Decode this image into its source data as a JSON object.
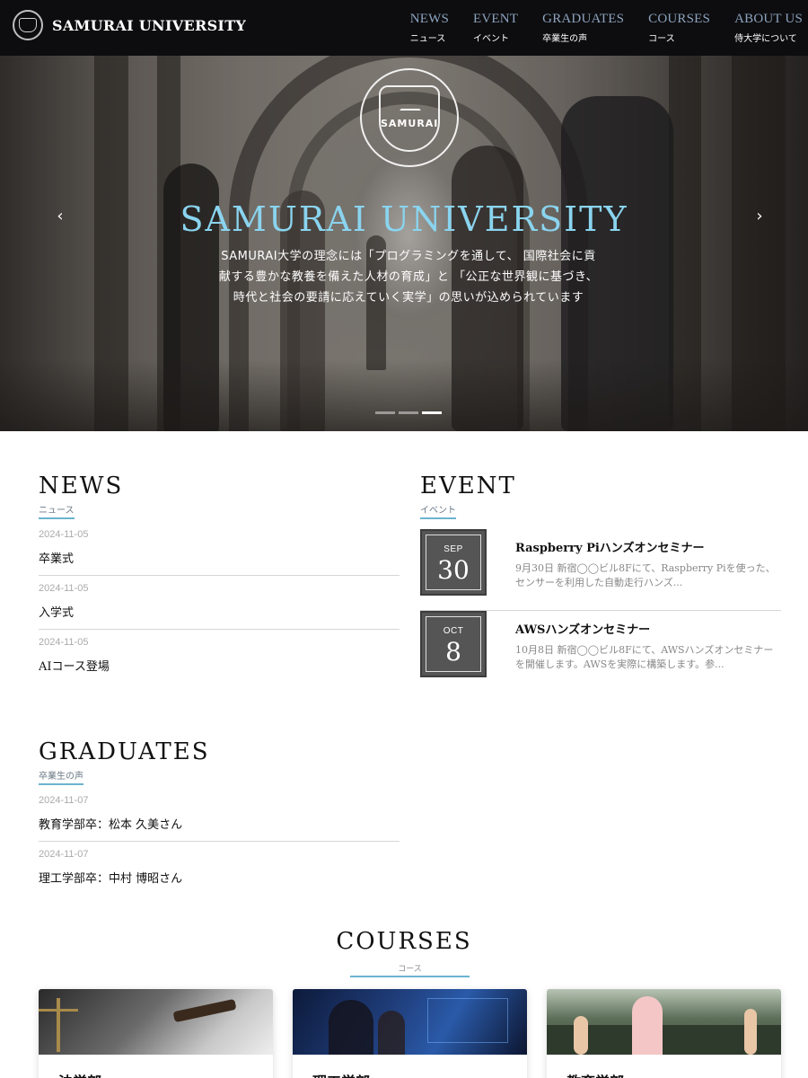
{
  "header": {
    "brand": "SAMURAI UNIVERSITY",
    "nav": [
      {
        "en": "NEWS",
        "jp": "ニュース"
      },
      {
        "en": "EVENT",
        "jp": "イベント"
      },
      {
        "en": "GRADUATES",
        "jp": "卒業生の声"
      },
      {
        "en": "COURSES",
        "jp": "コース"
      },
      {
        "en": "ABOUT US",
        "jp": "侍大学について"
      }
    ]
  },
  "hero": {
    "seal_text": "SAMURAI",
    "title": "SAMURAI UNIVERSITY",
    "text": "SAMURAI大学の理念には「プログラミングを通して、 国際社会に貢献する豊かな教養を備えた人材の育成」と 「公正な世界観に基づき、 時代と社会の要請に応えていく実学」の思いが込められています",
    "prev_icon": "‹",
    "next_icon": "›",
    "slides": 3,
    "active_slide": 3
  },
  "news": {
    "title": "NEWS",
    "subtitle": "ニュース",
    "items": [
      {
        "date": "2024-11-05",
        "title": "卒業式"
      },
      {
        "date": "2024-11-05",
        "title": "入学式"
      },
      {
        "date": "2024-11-05",
        "title": "AIコース登場"
      }
    ]
  },
  "event": {
    "title": "EVENT",
    "subtitle": "イベント",
    "items": [
      {
        "month": "SEP",
        "day": "30",
        "title": "Raspberry Piハンズオンセミナー",
        "desc": "9月30日 新宿◯◯ビル8Fにて、Raspberry Piを使った、センサーを利用した自動走行ハンズ..."
      },
      {
        "month": "OCT",
        "day": "8",
        "title": "AWSハンズオンセミナー",
        "desc": "10月8日 新宿◯◯ビル8Fにて、AWSハンズオンセミナーを開催します。AWSを実際に構築します。参..."
      }
    ]
  },
  "graduates": {
    "title": "GRADUATES",
    "subtitle": "卒業生の声",
    "items": [
      {
        "date": "2024-11-07",
        "title": "教育学部卒：松本 久美さん"
      },
      {
        "date": "2024-11-07",
        "title": "理工学部卒：中村 博昭さん"
      }
    ]
  },
  "courses": {
    "title": "COURSES",
    "subtitle": "コース",
    "items": [
      {
        "name": "法学部"
      },
      {
        "name": "理工学部"
      },
      {
        "name": "教育学部"
      }
    ]
  },
  "colors": {
    "accent": "#6bb4d0",
    "hero_title": "#8ad4ef",
    "nav_en": "#8da3bf",
    "header_bg": "#0d0d0f",
    "calendar_bg": "#555555"
  }
}
